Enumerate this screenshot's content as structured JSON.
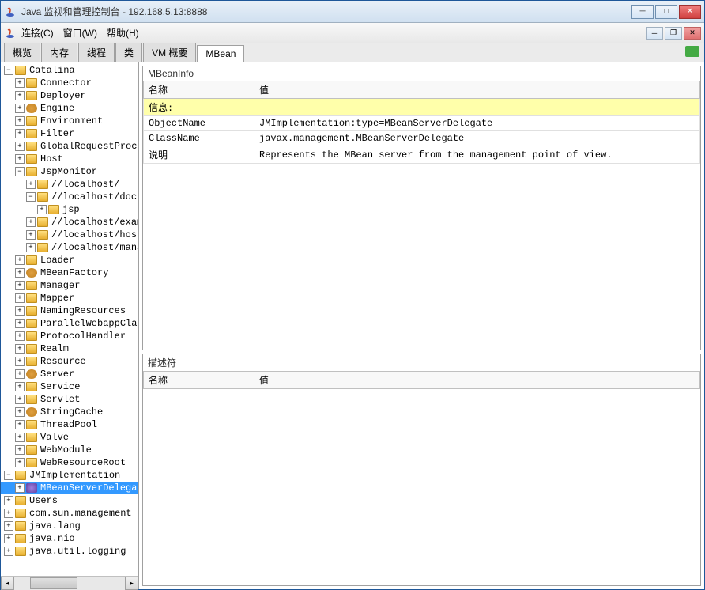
{
  "window": {
    "title": "Java 监视和管理控制台 - 192.168.5.13:8888"
  },
  "menu": {
    "connect": "连接(C)",
    "window": "窗口(W)",
    "help": "帮助(H)"
  },
  "tabs": {
    "overview": "概览",
    "memory": "内存",
    "threads": "线程",
    "classes": "类",
    "vm_summary": "VM 概要",
    "mbeans": "MBean"
  },
  "tree": {
    "catalina": "Catalina",
    "connector": "Connector",
    "deployer": "Deployer",
    "engine": "Engine",
    "environment": "Environment",
    "filter": "Filter",
    "global_request": "GlobalRequestProcessor",
    "host": "Host",
    "jsp_monitor": "JspMonitor",
    "jsp_localhost1": "//localhost/",
    "jsp_localhost_do": "//localhost/docs",
    "jsp": "jsp",
    "jsp_localhost_ex": "//localhost/examples",
    "jsp_localhost_ho": "//localhost/host-manager",
    "jsp_localhost_ma": "//localhost/manager",
    "loader": "Loader",
    "mbean_factory": "MBeanFactory",
    "manager": "Manager",
    "mapper": "Mapper",
    "naming_resources": "NamingResources",
    "parallel_webapp": "ParallelWebappClassLoader",
    "protocol_handler": "ProtocolHandler",
    "realm": "Realm",
    "resource": "Resource",
    "server": "Server",
    "service": "Service",
    "servlet": "Servlet",
    "string_cache": "StringCache",
    "thread_pool": "ThreadPool",
    "valve": "Valve",
    "web_module": "WebModule",
    "web_resource_root": "WebResourceRoot",
    "jm_implementation": "JMImplementation",
    "mbean_server_delegate": "MBeanServerDelegate",
    "users": "Users",
    "com_sun_management": "com.sun.management",
    "java_lang": "java.lang",
    "java_nio": "java.nio",
    "java_util_logging": "java.util.logging"
  },
  "mbean_info": {
    "title": "MBeanInfo",
    "col_name": "名称",
    "col_value": "值",
    "info_label": "信息:",
    "rows": [
      {
        "name": "ObjectName",
        "value": "JMImplementation:type=MBeanServerDelegate"
      },
      {
        "name": "ClassName",
        "value": "javax.management.MBeanServerDelegate"
      },
      {
        "name": "说明",
        "value": "Represents  the MBean server from the management point of view."
      }
    ]
  },
  "descriptor": {
    "title": "描述符",
    "col_name": "名称",
    "col_value": "值"
  }
}
